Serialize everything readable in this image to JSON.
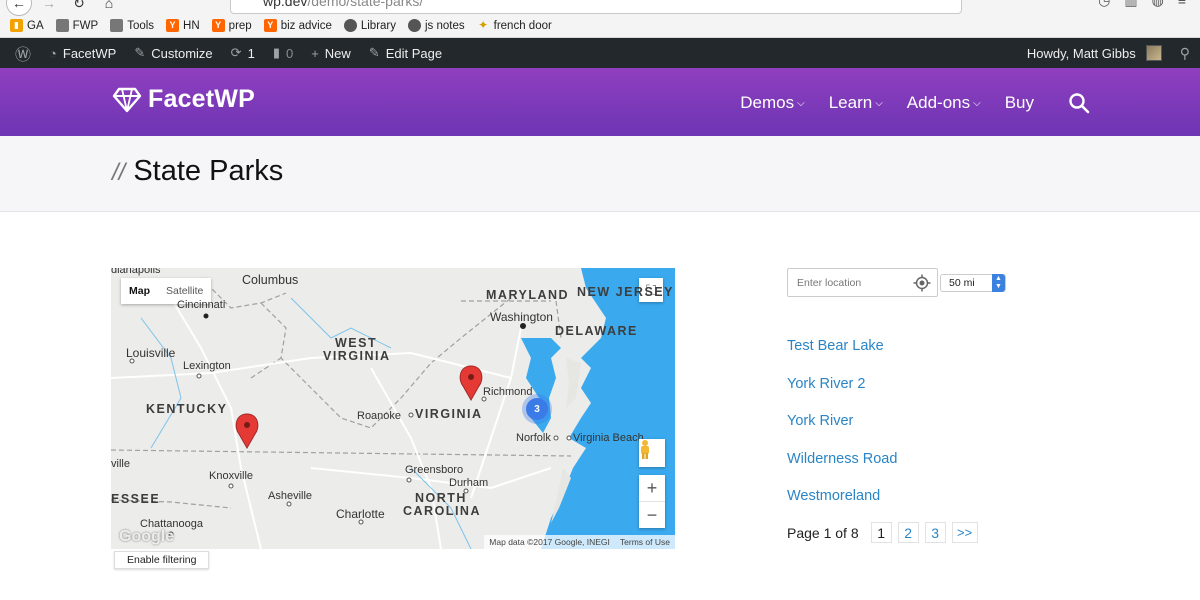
{
  "browser": {
    "url_host": "wp.dev",
    "url_path": "/demo/state-parks/",
    "bookmarks": [
      {
        "label": "GA",
        "icon": "analytics-icon"
      },
      {
        "label": "FWP",
        "icon": "folder-icon"
      },
      {
        "label": "Tools",
        "icon": "folder-icon"
      },
      {
        "label": "HN",
        "icon": "y-icon"
      },
      {
        "label": "prep",
        "icon": "y-icon"
      },
      {
        "label": "biz advice",
        "icon": "y-icon"
      },
      {
        "label": "Library",
        "icon": "globe-icon"
      },
      {
        "label": "js notes",
        "icon": "globe-icon"
      },
      {
        "label": "french door",
        "icon": "star-icon"
      }
    ]
  },
  "adminbar": {
    "site": "FacetWP",
    "customize": "Customize",
    "updates": "1",
    "comments": "0",
    "new": "New",
    "edit_page": "Edit Page",
    "howdy": "Howdy, Matt Gibbs"
  },
  "header": {
    "logo": "FacetWP",
    "nav": [
      "Demos",
      "Learn",
      "Add-ons",
      "Buy"
    ]
  },
  "page": {
    "title": "State Parks",
    "title_prefix": "//"
  },
  "map": {
    "type_map": "Map",
    "type_satellite": "Satellite",
    "cluster_count": "3",
    "attribution": "Map data ©2017 Google, INEGI",
    "terms": "Terms of Use",
    "google": "Google",
    "enable_filtering": "Enable filtering",
    "labels": {
      "indianapolis": "dianapolis",
      "columbus": "Columbus",
      "cincinnati": "Cincinnati",
      "maryland": "MARYLAND",
      "new_jersey": "NEW JERSEY",
      "washington": "Washington",
      "delaware": "DELAWARE",
      "west_virginia_1": "WEST",
      "west_virginia_2": "VIRGINIA",
      "louisville": "Louisville",
      "lexington": "Lexington",
      "richmond": "Richmond",
      "kentucky": "KENTUCKY",
      "roanoke": "Roanoke",
      "virginia": "VIRGINIA",
      "norfolk": "Norfolk",
      "virginia_beach": "Virginia Beach",
      "ville": "ville",
      "greensboro": "Greensboro",
      "knoxville": "Knoxville",
      "durham": "Durham",
      "tennessee": "ESSEE",
      "asheville": "Asheville",
      "north_carolina_1": "NORTH",
      "north_carolina_2": "CAROLINA",
      "charlotte": "Charlotte",
      "chattanooga": "Chattanooga"
    }
  },
  "sidebar": {
    "location_placeholder": "Enter location",
    "radius": "50 mi",
    "results": [
      "Test Bear Lake",
      "York River 2",
      "York River",
      "Wilderness Road",
      "Westmoreland"
    ],
    "pager": {
      "label": "Page 1 of 8",
      "pages": [
        "1",
        "2",
        "3"
      ],
      "next": ">>"
    }
  },
  "colors": {
    "header_purple": "#7a38b8",
    "link_blue": "#2a85c6",
    "adminbar": "#23282d",
    "water": "#3aa9ee"
  }
}
